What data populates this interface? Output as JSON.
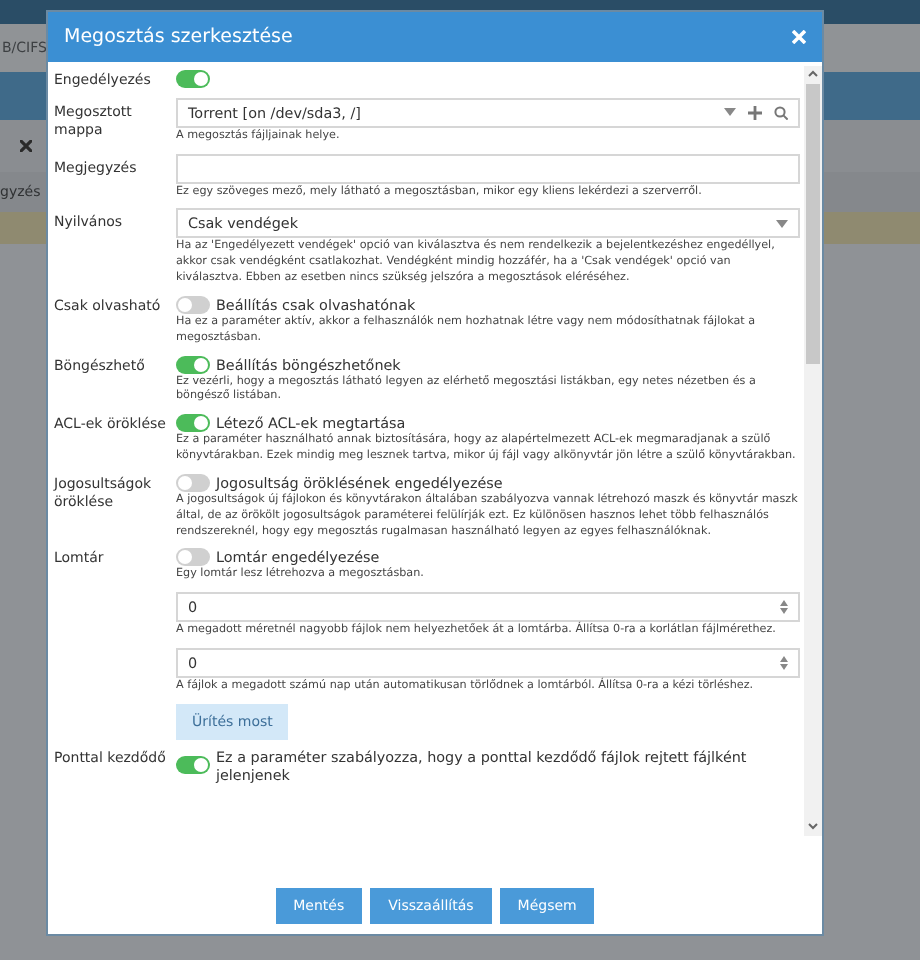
{
  "background": {
    "tab_label": "B/CIFS",
    "column_header": "gyzés"
  },
  "dialog": {
    "title": "Megosztás szerkesztése"
  },
  "fields": [
    {
      "kind": "toggle",
      "label": "Engedélyezés",
      "on": true
    },
    {
      "kind": "folder",
      "label": "Megosztott mappa",
      "value": "Torrent [on /dev/sda3, /]",
      "hint": "A megosztás fájljainak helye."
    },
    {
      "kind": "text",
      "label": "Megjegyzés",
      "hint": "Ez egy szöveges mező, mely látható a megosztásban, mikor egy kliens lekérdezi a szerverről."
    },
    {
      "kind": "select",
      "label": "Nyilvános",
      "value": "Csak vendégek",
      "hint": "Ha az 'Engedélyezett vendégek' opció van kiválasztva és nem rendelkezik a bejelentkezéshez engedéllyel, akkor csak vendégként csatlakozhat. Vendégként mindig hozzáfér, ha a 'Csak vendégek' opció van kiválasztva. Ebben az esetben nincs szükség jelszóra a megosztások eléréséhez."
    },
    {
      "kind": "toggle",
      "label": "Csak olvasható",
      "on": false,
      "caption": "Beállítás csak olvashatónak",
      "hint": "Ha ez a paraméter aktív, akkor a felhasználók nem hozhatnak létre vagy nem módosíthatnak fájlokat a megosztásban."
    },
    {
      "kind": "toggle",
      "label": "Böngészhető",
      "on": true,
      "caption": "Beállítás böngészhetőnek",
      "hint": "Ez vezérli, hogy a megosztás látható legyen az elérhető megosztási listákban, egy netes nézetben és a böngésző listában."
    },
    {
      "kind": "toggle",
      "label": "ACL-ek öröklése",
      "on": true,
      "caption": "Létező ACL-ek megtartása",
      "hint": "Ez a paraméter használható annak biztosítására, hogy az alapértelmezett ACL-ek megmaradjanak a szülő könyvtárakban. Ezek mindig meg lesznek tartva, mikor új fájl vagy alkönyvtár jön létre a szülő könyvtárakban."
    },
    {
      "kind": "toggle",
      "label": "Jogosultságok öröklése",
      "on": false,
      "caption": "Jogosultság öröklésének engedélyezése",
      "hint": "A jogosultságok új fájlokon és könyvtárakon általában szabályozva vannak létrehozó maszk és könyvtár maszk által, de az örökölt jogosultságok paraméterei felülírják ezt. Ez különösen hasznos lehet több felhasználós rendszereknél, hogy egy megosztás rugalmasan használható legyen az egyes felhasználóknak."
    },
    {
      "kind": "toggle",
      "label": "Lomtár",
      "on": false,
      "caption": "Lomtár engedélyezése",
      "hint": "Egy lomtár lesz létrehozva a megosztásban."
    },
    {
      "kind": "number",
      "value": "0",
      "hint": "A megadott méretnél nagyobb fájlok nem helyezhetőek át a lomtárba. Állítsa 0-ra a korlátlan fájlmérethez."
    },
    {
      "kind": "number",
      "value": "0",
      "hint": "A fájlok a megadott számú nap után automatikusan törlődnek a lomtárból. Állítsa 0-ra a kézi törléshez."
    },
    {
      "kind": "button",
      "label": "Ürítés most",
      "disabled": true
    },
    {
      "kind": "toggle",
      "label": "Ponttal kezdődő",
      "on": true,
      "caption": "Ez a paraméter szabályozza, hogy a ponttal kezdődő fájlok rejtett fájlként jelenjenek"
    }
  ],
  "buttons": [
    "Mentés",
    "Visszaállítás",
    "Mégsem"
  ]
}
